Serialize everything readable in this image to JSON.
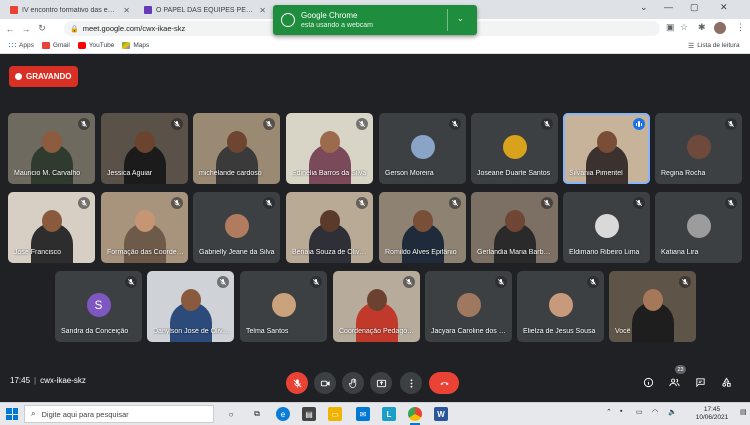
{
  "browser": {
    "tabs": [
      {
        "title": "IV encontro formativo das equip",
        "favicon": "gmail-icon",
        "active": false
      },
      {
        "title": "O PAPEL DAS EQUIPES PEDAGÓ",
        "favicon": "forms-icon",
        "active": false
      },
      {
        "title": "",
        "favicon": "meet-icon",
        "active": true
      }
    ],
    "new_tab": "+",
    "url": "meet.google.com/cwx-ikae-skz",
    "bookmarks": [
      "Apps",
      "Gmail",
      "YouTube",
      "Maps"
    ],
    "reading_list": "Lista de leitura"
  },
  "notification": {
    "title": "Google Chrome",
    "message": "está usando a webcam"
  },
  "meet": {
    "recording_label": "GRAVANDO",
    "time": "17:45",
    "separator": "|",
    "meeting_code": "cwx-ikae-skz",
    "participants_count": "23",
    "participants": [
      {
        "name": "Mauricio M. Carvalho",
        "kind": "video",
        "bg": "#6f6a5f",
        "skin": "#8d5b3e",
        "shirt": "#2f3b2f",
        "speaking": false
      },
      {
        "name": "Jessica Aguiar",
        "kind": "video",
        "bg": "#5a5248",
        "skin": "#6b4430",
        "shirt": "#1b1b1b",
        "speaking": false
      },
      {
        "name": "michelande cardoso",
        "kind": "video",
        "bg": "#9a8a74",
        "skin": "#6d4530",
        "shirt": "#3a3a3a",
        "speaking": false
      },
      {
        "name": "Edinélia Barros da Silva",
        "kind": "video",
        "bg": "#d8d4c6",
        "skin": "#9c6b4e",
        "shirt": "#7b4a5a",
        "speaking": false
      },
      {
        "name": "Gerson Moreira",
        "kind": "avatar",
        "bg": "#3c4043",
        "avatar": "#8aa4c8",
        "speaking": false
      },
      {
        "name": "Joseane Duarte Santos",
        "kind": "avatar",
        "bg": "#3c4043",
        "avatar": "#d8a21c",
        "speaking": false
      },
      {
        "name": "Silvania Pimentel",
        "kind": "video",
        "bg": "#c7b39a",
        "skin": "#7a4d36",
        "shirt": "#3b3230",
        "speaking": true
      },
      {
        "name": "Regina Rocha",
        "kind": "avatar",
        "bg": "#3c4043",
        "avatar": "#6f4a3c",
        "speaking": false
      },
      {
        "name": "José Francisco",
        "kind": "video",
        "bg": "#d7cfc3",
        "skin": "#8a5a3d",
        "shirt": "#2d2d2d",
        "speaking": false
      },
      {
        "name": "Formação das Coordenadoras",
        "kind": "video",
        "bg": "#a8947c",
        "skin": "#c59574",
        "shirt": "#6d5a48",
        "speaking": false
      },
      {
        "name": "Gabrielly Jeane da Silva",
        "kind": "avatar",
        "bg": "#3c4043",
        "avatar": "#b07b5f",
        "speaking": false
      },
      {
        "name": "Benaia Souza de Oliveira",
        "kind": "video",
        "bg": "#b9aa96",
        "skin": "#5c3a2a",
        "shirt": "#2f2f38",
        "speaking": false
      },
      {
        "name": "Romildo Alves Epifânio",
        "kind": "video",
        "bg": "#8e8372",
        "skin": "#7a4f38",
        "shirt": "#1f2b3a",
        "speaking": false
      },
      {
        "name": "Gerlandia Maria Barbosa",
        "kind": "video",
        "bg": "#7c6f63",
        "skin": "#6e4633",
        "shirt": "#2a2a2a",
        "speaking": false
      },
      {
        "name": "Eldimario Ribeiro Lima",
        "kind": "avatar",
        "bg": "#3c4043",
        "avatar": "#d9d9d9",
        "speaking": false
      },
      {
        "name": "Katiana Lira",
        "kind": "avatar",
        "bg": "#3c4043",
        "avatar": "#9c9c9c",
        "speaking": false
      },
      {
        "name": "Sandra da Conceição",
        "kind": "letter",
        "bg": "#3c4043",
        "letter": "S",
        "speaking": false
      },
      {
        "name": "Danylson José de Oliveira",
        "kind": "video",
        "bg": "#cfd2d6",
        "skin": "#8a5a3e",
        "shirt": "#2c4a7a",
        "speaking": false
      },
      {
        "name": "Telma Santos",
        "kind": "avatar",
        "bg": "#3c4043",
        "avatar": "#caa27c",
        "speaking": false
      },
      {
        "name": "Coordenação Pedagógica",
        "kind": "video",
        "bg": "#b7ab9c",
        "skin": "#6b4230",
        "shirt": "#c0392b",
        "speaking": false
      },
      {
        "name": "Jacyara Caroline dos Santos",
        "kind": "avatar",
        "bg": "#3c4043",
        "avatar": "#a07860",
        "speaking": false
      },
      {
        "name": "Elielza de Jesus Sousa",
        "kind": "avatar",
        "bg": "#3c4043",
        "avatar": "#c89a7c",
        "speaking": false
      },
      {
        "name": "Você",
        "kind": "video",
        "bg": "#5f5448",
        "skin": "#a5785a",
        "shirt": "#1e1e1e",
        "speaking": false
      }
    ]
  },
  "taskbar": {
    "search_placeholder": "Digite aqui para pesquisar",
    "time": "17:45",
    "date": "10/06/2021"
  },
  "colors": {
    "meet_bg": "#202124",
    "tile_bg": "#3c4043",
    "recording_red": "#d93025",
    "hangup_red": "#ea4335",
    "notification_green": "#1e8e3e",
    "speaking_blue": "#1a73e8"
  }
}
